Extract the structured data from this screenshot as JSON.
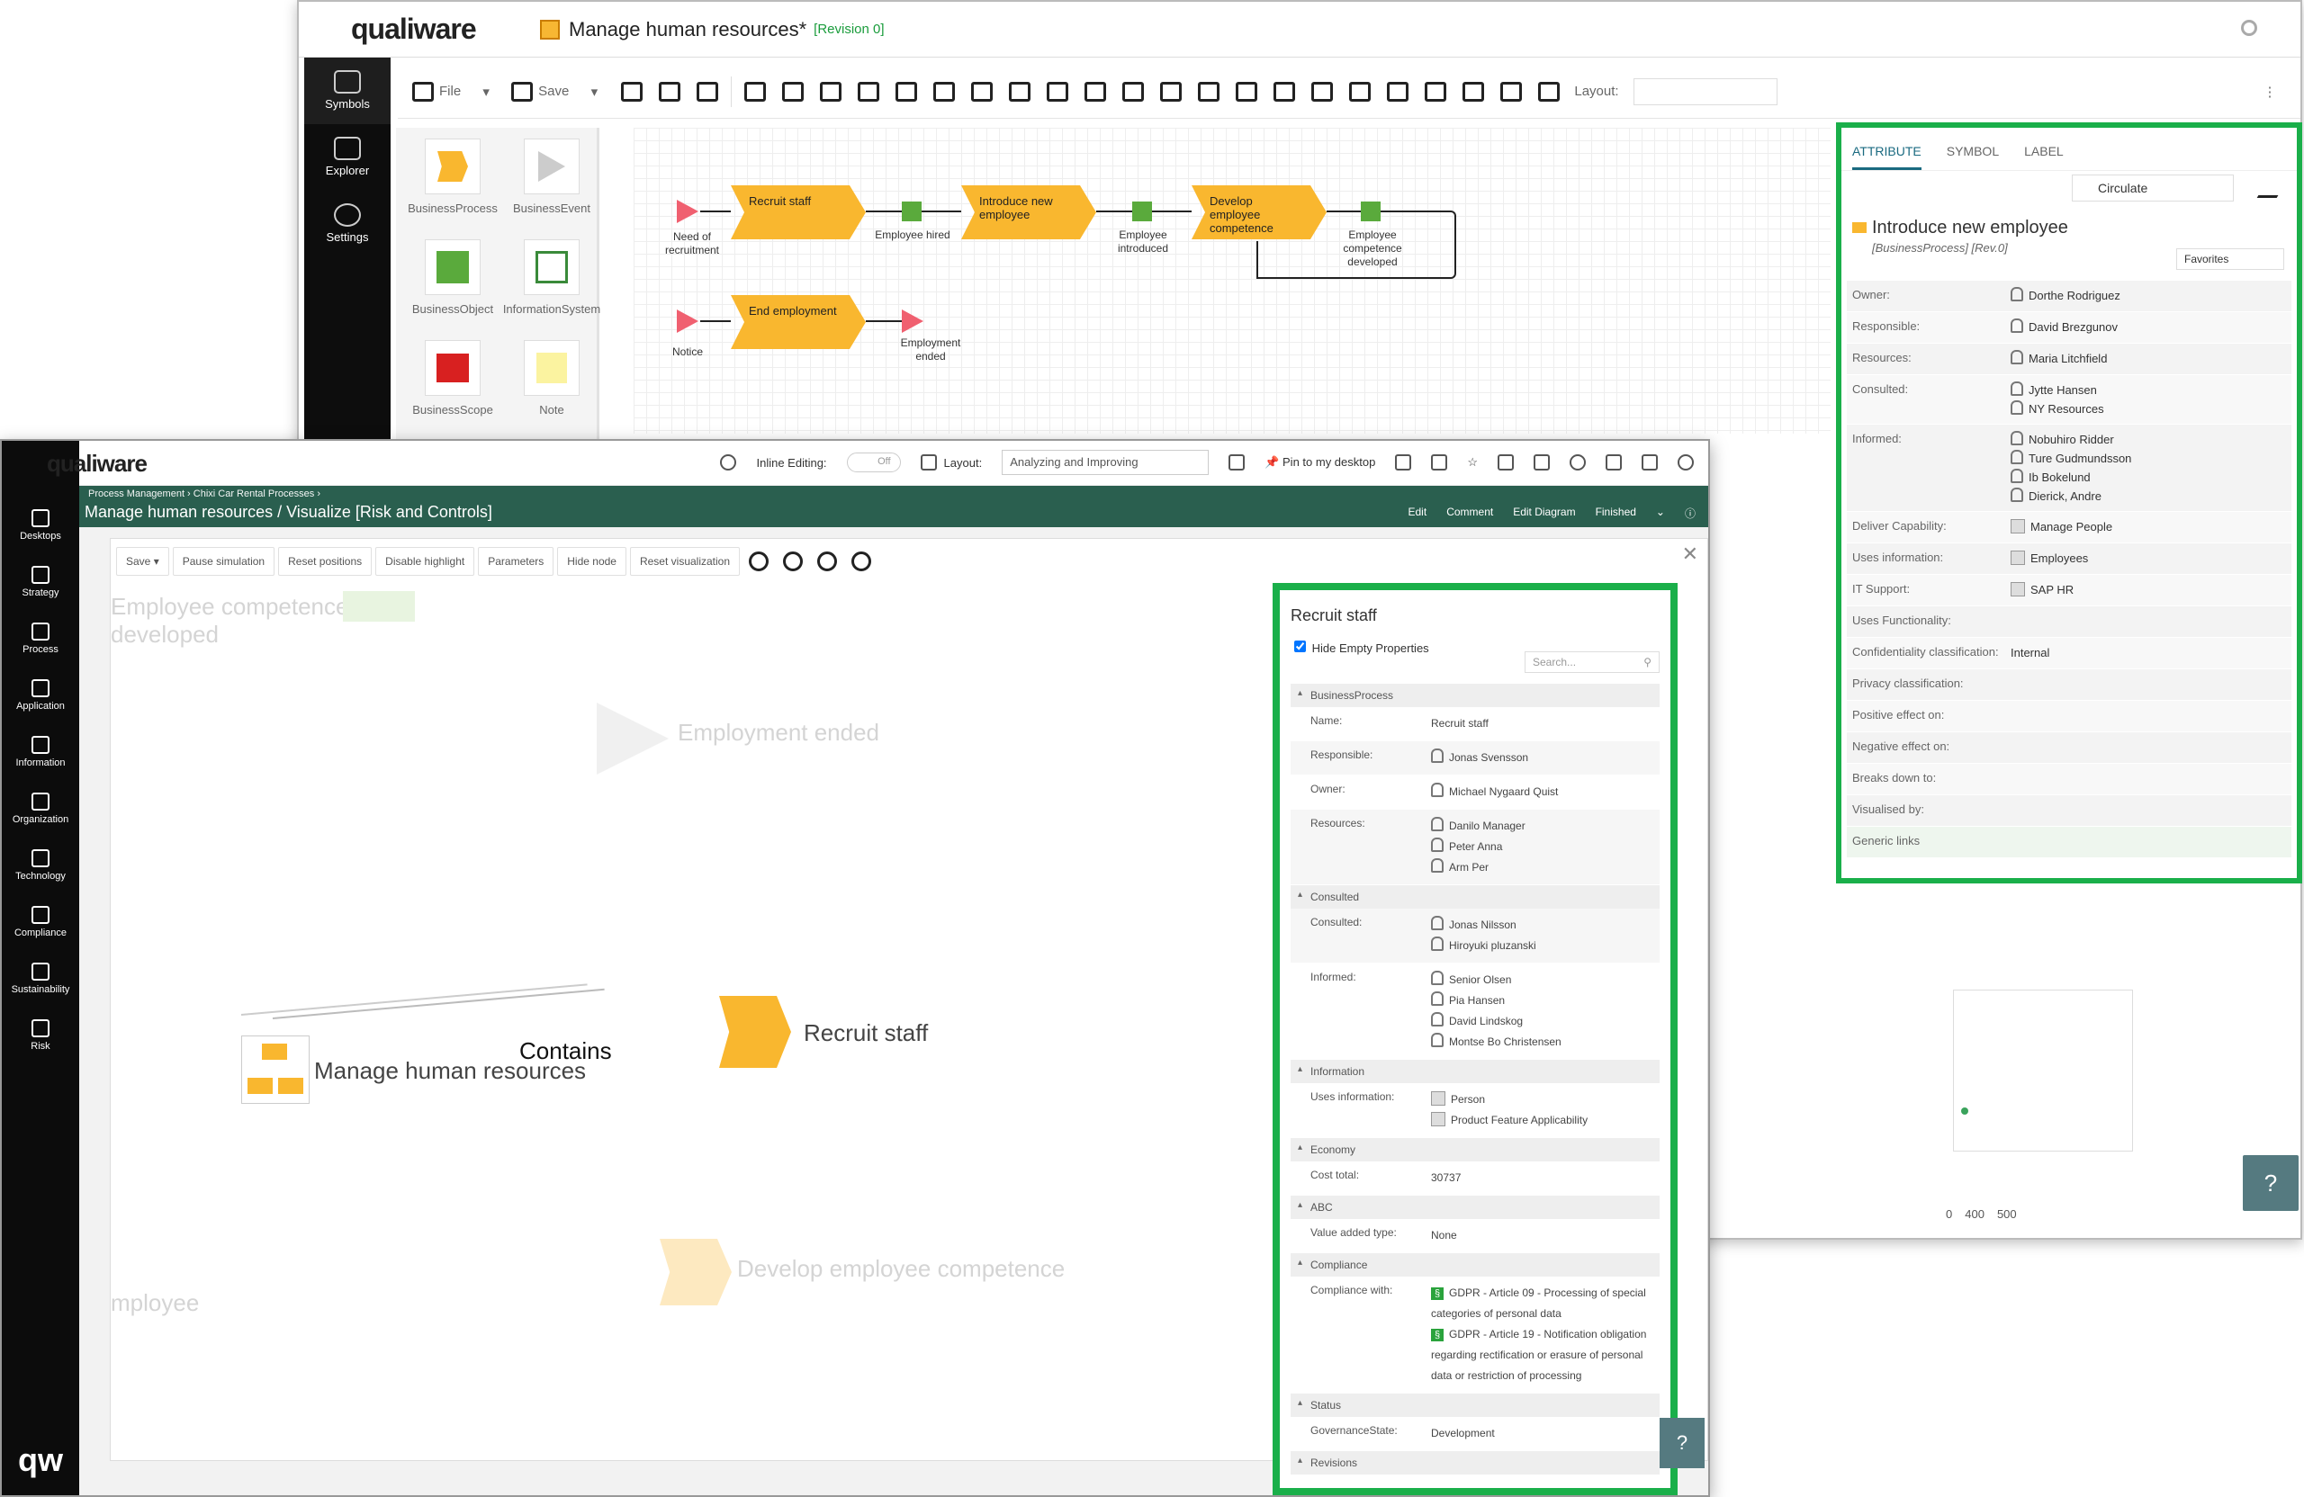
{
  "back": {
    "logo": "qualiware",
    "title": "Manage human resources",
    "asterisk": "*",
    "revision": "[Revision 0]",
    "leftbar": [
      "Symbols",
      "Explorer",
      "Settings"
    ],
    "toolbar": {
      "file": "File",
      "save": "Save",
      "layout_label": "Layout:"
    },
    "palette": [
      "BusinessProcess",
      "BusinessEvent",
      "BusinessObject",
      "InformationSystem",
      "BusinessScope",
      "Note"
    ],
    "diagram": {
      "p1": "Recruit staff",
      "p2": "Introduce new employee",
      "p3": "Develop employee competence",
      "p4": "End employment",
      "e1": "Need of recruitment",
      "e2": "Notice",
      "e3": "Employment ended",
      "o1": "Employee hired",
      "o2": "Employee introduced",
      "o3": "Employee competence developed"
    },
    "attr": {
      "tabs": [
        "ATTRIBUTE",
        "SYMBOL",
        "LABEL"
      ],
      "circulate": "Circulate",
      "title": "Introduce new employee",
      "subtitle": "[BusinessProcess] [Rev.0]",
      "favorites": "Favorites",
      "rows": [
        {
          "k": "Owner:",
          "v": [
            "Dorthe Rodriguez"
          ],
          "t": "person"
        },
        {
          "k": "Responsible:",
          "v": [
            "David Brezgunov"
          ],
          "t": "person"
        },
        {
          "k": "Resources:",
          "v": [
            "Maria Litchfield"
          ],
          "t": "person"
        },
        {
          "k": "Consulted:",
          "v": [
            "Jytte Hansen",
            "NY Resources"
          ],
          "t": "person"
        },
        {
          "k": "Informed:",
          "v": [
            "Nobuhiro Ridder",
            "Ture Gudmundsson",
            "Ib Bokelund",
            "Dierick, Andre"
          ],
          "t": "person"
        },
        {
          "k": "Deliver Capability:",
          "v": [
            "Manage People"
          ],
          "t": "sq"
        },
        {
          "k": "Uses information:",
          "v": [
            "Employees"
          ],
          "t": "sq"
        },
        {
          "k": "IT Support:",
          "v": [
            "SAP HR"
          ],
          "t": "sq"
        },
        {
          "k": "Uses Functionality:",
          "v": [],
          "t": ""
        },
        {
          "k": "Confidentiality classification:",
          "v": [
            "Internal"
          ],
          "t": ""
        },
        {
          "k": "Privacy classification:",
          "v": [],
          "t": ""
        },
        {
          "k": "Positive effect on:",
          "v": [],
          "t": ""
        },
        {
          "k": "Negative effect on:",
          "v": [],
          "t": ""
        },
        {
          "k": "Breaks down to:",
          "v": [],
          "t": ""
        },
        {
          "k": "Visualised by:",
          "v": [],
          "t": ""
        }
      ],
      "generic": "Generic links"
    },
    "scale": [
      "0",
      "400",
      "500"
    ],
    "help": "?"
  },
  "front": {
    "logo": "qualiware",
    "leftbar": [
      "Desktops",
      "Strategy",
      "Process",
      "Application",
      "Information",
      "Organization",
      "Technology",
      "Compliance",
      "Sustainability",
      "Risk"
    ],
    "mini_logo": "qw",
    "inline_editing": "Inline Editing:",
    "toggle": "Off",
    "layout_label": "Layout:",
    "layout_value": "Analyzing and Improving",
    "pin": "Pin to my desktop",
    "crumbs": "Process Management  ›  Chixi Car Rental Processes  ›",
    "title": "Manage human resources / Visualize [Risk and Controls]",
    "actions": [
      "Edit",
      "Comment",
      "Edit Diagram",
      "Finished"
    ],
    "viz_toolbar": [
      "Save",
      "Pause simulation",
      "Reset positions",
      "Disable highlight",
      "Parameters",
      "Hide node",
      "Reset visualization"
    ],
    "ghosts": [
      "Employee competence developed",
      "Employment ended",
      "Develop employee competence",
      "mployee"
    ],
    "nodes": {
      "manage": "Manage human resources",
      "contains": "Contains",
      "recruit": "Recruit staff"
    },
    "props": {
      "title": "Recruit staff",
      "hide_empty": "Hide Empty Properties",
      "search": "Search...",
      "sections": [
        {
          "name": "BusinessProcess",
          "rows": [
            {
              "k": "Name:",
              "v": [
                "Recruit staff"
              ],
              "t": ""
            },
            {
              "k": "Responsible:",
              "v": [
                "Jonas Svensson"
              ],
              "t": "person"
            },
            {
              "k": "Owner:",
              "v": [
                "Michael Nygaard Quist"
              ],
              "t": "person"
            },
            {
              "k": "Resources:",
              "v": [
                "Danilo Manager",
                "Peter Anna",
                "Arm Per"
              ],
              "t": "person"
            }
          ]
        },
        {
          "name": "Consulted",
          "rows": [
            {
              "k": "Consulted:",
              "v": [
                "Jonas Nilsson",
                "Hiroyuki pluzanski"
              ],
              "t": "person"
            },
            {
              "k": "Informed:",
              "v": [
                "Senior Olsen",
                "Pia Hansen",
                "David Lindskog",
                "Montse Bo Christensen"
              ],
              "t": "person"
            }
          ]
        },
        {
          "name": "Information",
          "rows": [
            {
              "k": "Uses information:",
              "v": [
                "Person",
                "Product Feature Applicability"
              ],
              "t": "sq"
            }
          ]
        },
        {
          "name": "Economy",
          "rows": [
            {
              "k": "Cost total:",
              "v": [
                "30737"
              ],
              "t": ""
            }
          ]
        },
        {
          "name": "ABC",
          "rows": [
            {
              "k": "Value added type:",
              "v": [
                "None"
              ],
              "t": ""
            }
          ]
        },
        {
          "name": "Compliance",
          "rows": [
            {
              "k": "Compliance with:",
              "v": [
                "GDPR - Article 09 - Processing of special categories of personal data",
                "GDPR - Article 19 - Notification obligation regarding rectification or erasure of personal data or restriction of processing"
              ],
              "t": "gdpr"
            }
          ]
        },
        {
          "name": "Status",
          "rows": [
            {
              "k": "GovernanceState:",
              "v": [
                "Development"
              ],
              "t": ""
            }
          ]
        },
        {
          "name": "Revisions",
          "rows": []
        }
      ]
    },
    "help": "?"
  }
}
